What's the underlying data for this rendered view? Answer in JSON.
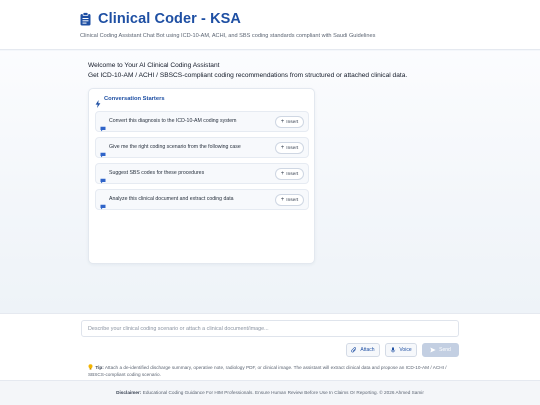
{
  "app": {
    "title": "Clinical Coder - KSA",
    "subtitle": "Clinical Coding Assistant Chat Bot using ICD-10-AM, ACHI, and SBS coding standards compliant with Saudi Guidelines"
  },
  "welcome": {
    "line1": "Welcome to Your AI Clinical Coding Assistant",
    "line2": "Get ICD-10-AM / ACHI / SBSCS-compliant coding recommendations from structured or attached clinical data."
  },
  "starters": {
    "title": "Conversation Starters",
    "insert_label": "Insert",
    "items": [
      "Convert this diagnosis to the ICD-10-AM coding system",
      "Give me the right coding scenario from the following case",
      "Suggest SBS codes for these procedures",
      "Analyze this clinical document and extract coding data"
    ]
  },
  "composer": {
    "placeholder": "Describe your clinical coding scenario or attach a clinical document/image...",
    "attach_label": "Attach",
    "voice_label": "Voice",
    "send_label": "Send",
    "tip_label": "Tip:",
    "tip_text": "Attach a de-identified discharge summary, operative note, radiology PDF, or clinical image. The assistant will extract clinical data and propose an ICD-10-AM / ACHI / SBSCS-compliant coding scenario."
  },
  "footer": {
    "disclaimer_label": "Disclaimer:",
    "disclaimer_text": "Educational Coding Guidance For HIM Professionals. Ensure Human Review Before Use In Claims Or Reporting. © 2026 Ahmed Samir"
  },
  "icons": {
    "title_icon": "clipboard-icon",
    "starters_icon": "bolt-icon",
    "starter_icon": "chat-bubble-icon",
    "attach_icon": "paperclip-icon",
    "voice_icon": "microphone-icon",
    "send_icon": "send-icon",
    "tip_icon": "lightbulb-icon"
  },
  "colors": {
    "accent": "#1e4fa3",
    "send_disabled": "#c3cfe2",
    "tip_bulb": "#f4b400"
  }
}
